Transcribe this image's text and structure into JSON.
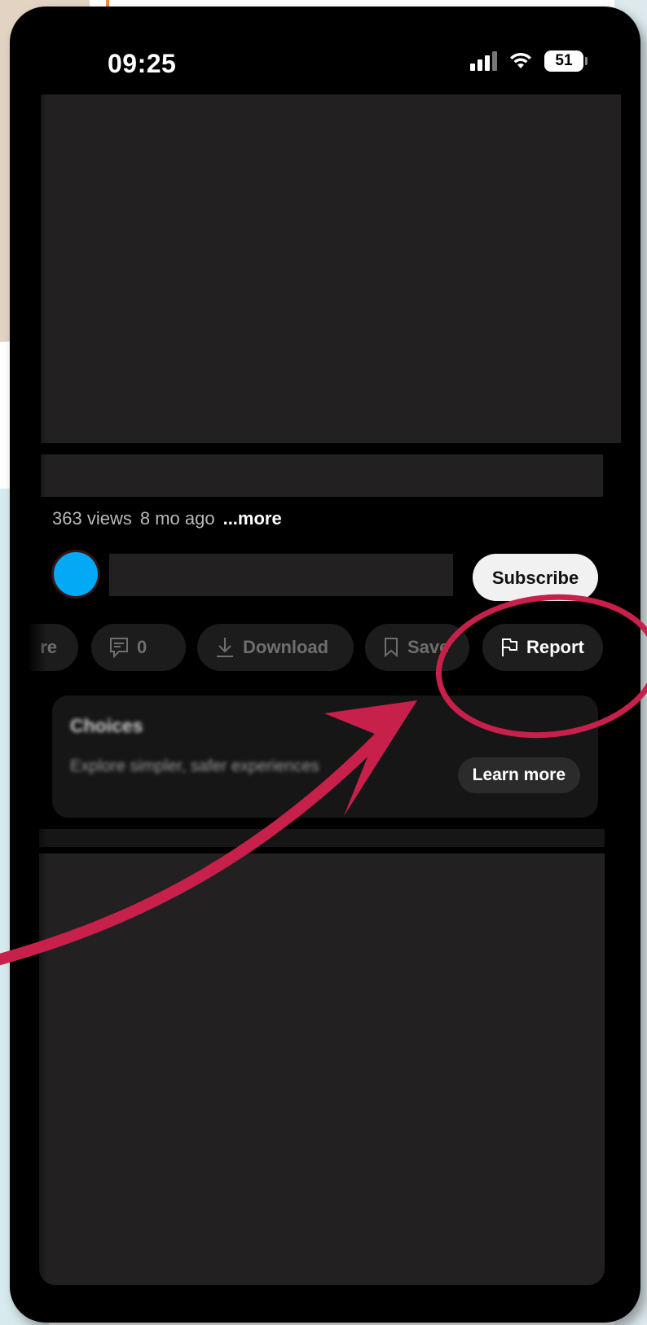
{
  "status_bar": {
    "time": "09:25",
    "battery": "51"
  },
  "video": {
    "views": "363 views",
    "age": "8 mo ago",
    "more_label": "...more"
  },
  "channel": {
    "subscribe_label": "Subscribe",
    "avatar_color": "#03a9f4"
  },
  "actions": {
    "share_label": "re",
    "comments_count": "0",
    "download_label": "Download",
    "save_label": "Save",
    "report_label": "Report"
  },
  "choices_card": {
    "title": "Choices",
    "description": "Explore simpler, safer experiences",
    "button_label": "Learn more"
  },
  "annotation": {
    "color": "#c6204b"
  }
}
